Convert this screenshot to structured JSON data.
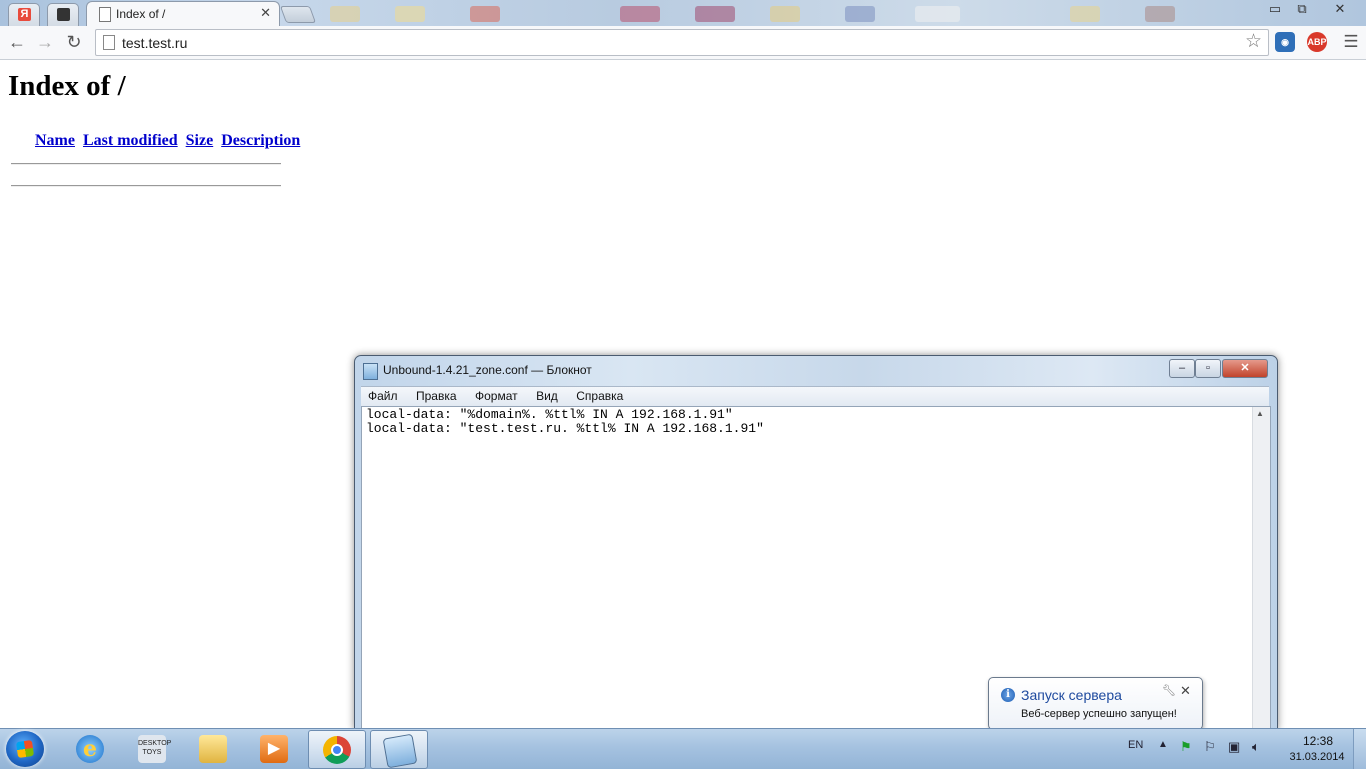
{
  "browser": {
    "tab_active_title": "Index of /",
    "address": "test.test.ru",
    "pinned_tab_icon": "Я",
    "extensions": [
      "ABP"
    ]
  },
  "page": {
    "heading": "Index of /",
    "columns": [
      "Name",
      "Last modified",
      "Size",
      "Description"
    ]
  },
  "notepad": {
    "title": "Unbound-1.4.21_zone.conf — Блокнот",
    "menu": [
      "Файл",
      "Правка",
      "Формат",
      "Вид",
      "Справка"
    ],
    "lines": [
      "local-data: \"%domain%. %ttl% IN A 192.168.1.91\"",
      "local-data: \"test.test.ru. %ttl% IN A 192.168.1.91\""
    ]
  },
  "balloon": {
    "title": "Запуск сервера",
    "text": "Веб-сервер успешно запущен!"
  },
  "taskbar": {
    "lang": "EN",
    "time": "12:38",
    "date": "31.03.2014",
    "dt_label": "DESKTOP TOYS"
  },
  "colors": {
    "link": "#0000cc",
    "balloon_title": "#1e4a9e",
    "taskbar": "#a5c2e0"
  }
}
